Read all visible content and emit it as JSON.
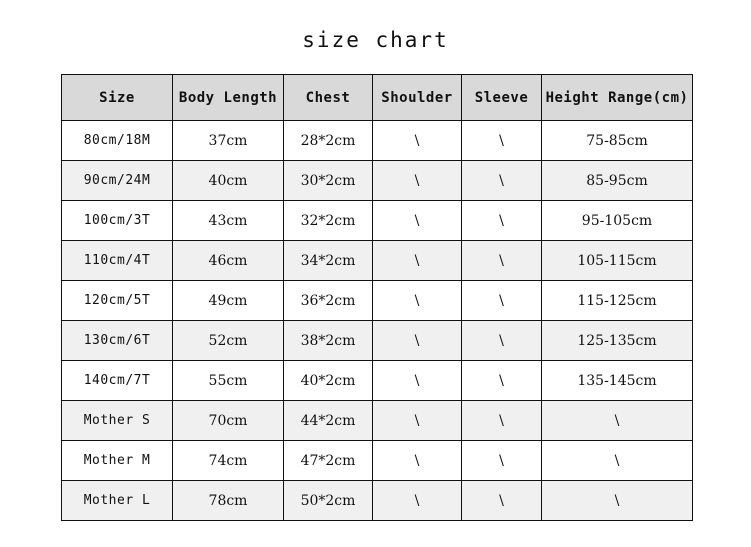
{
  "title": "size chart",
  "table": {
    "headers": [
      "Size",
      "Body Length",
      "Chest",
      "Shoulder",
      "Sleeve",
      "Height Range(cm)"
    ],
    "rows": [
      {
        "size": "80cm/18M",
        "body_length": "37cm",
        "chest": "28*2cm",
        "shoulder": "\\",
        "sleeve": "\\",
        "height_range": "75-85cm"
      },
      {
        "size": "90cm/24M",
        "body_length": "40cm",
        "chest": "30*2cm",
        "shoulder": "\\",
        "sleeve": "\\",
        "height_range": "85-95cm"
      },
      {
        "size": "100cm/3T",
        "body_length": "43cm",
        "chest": "32*2cm",
        "shoulder": "\\",
        "sleeve": "\\",
        "height_range": "95-105cm"
      },
      {
        "size": "110cm/4T",
        "body_length": "46cm",
        "chest": "34*2cm",
        "shoulder": "\\",
        "sleeve": "\\",
        "height_range": "105-115cm"
      },
      {
        "size": "120cm/5T",
        "body_length": "49cm",
        "chest": "36*2cm",
        "shoulder": "\\",
        "sleeve": "\\",
        "height_range": "115-125cm"
      },
      {
        "size": "130cm/6T",
        "body_length": "52cm",
        "chest": "38*2cm",
        "shoulder": "\\",
        "sleeve": "\\",
        "height_range": "125-135cm"
      },
      {
        "size": "140cm/7T",
        "body_length": "55cm",
        "chest": "40*2cm",
        "shoulder": "\\",
        "sleeve": "\\",
        "height_range": "135-145cm"
      },
      {
        "size": "Mother S",
        "body_length": "70cm",
        "chest": "44*2cm",
        "shoulder": "\\",
        "sleeve": "\\",
        "height_range": "\\"
      },
      {
        "size": "Mother M",
        "body_length": "74cm",
        "chest": "47*2cm",
        "shoulder": "\\",
        "sleeve": "\\",
        "height_range": "\\"
      },
      {
        "size": "Mother L",
        "body_length": "78cm",
        "chest": "50*2cm",
        "shoulder": "\\",
        "sleeve": "\\",
        "height_range": "\\"
      }
    ]
  },
  "colors": {
    "page_background": "#ffffff",
    "header_background": "#d9d9d9",
    "alt_row_background": "#f0f0f0",
    "border": "#111111",
    "text": "#111111"
  }
}
